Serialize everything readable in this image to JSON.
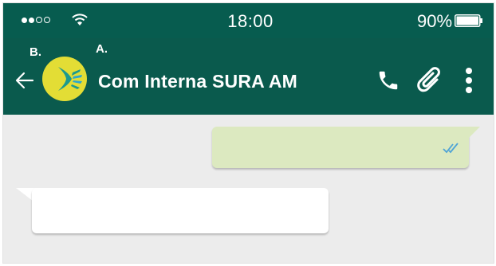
{
  "statusbar": {
    "signal_bars": [
      true,
      true,
      false,
      false
    ],
    "wifi_icon": "wifi-icon",
    "time": "18:00",
    "battery_percent": "90%",
    "battery_level": 0.9
  },
  "header": {
    "annotation_b": "B.",
    "annotation_a": "A.",
    "back_icon": "arrow-left-icon",
    "avatar_icon": "sura-logo",
    "title": "Com Interna SURA AM",
    "actions": [
      "phone-icon",
      "paperclip-icon",
      "more-vert-icon"
    ]
  },
  "chat": {
    "outgoing": {
      "text": "",
      "status_icon": "double-check-icon"
    },
    "incoming": {
      "text": ""
    }
  },
  "colors": {
    "statusbar": "#075c4f",
    "header": "#0a5a4d",
    "avatar": "#e3dd35",
    "chat_background": "#ececec",
    "bubble_outgoing": "#dce9c0",
    "bubble_incoming": "#ffffff",
    "read_ticks": "#4fa3d6"
  }
}
